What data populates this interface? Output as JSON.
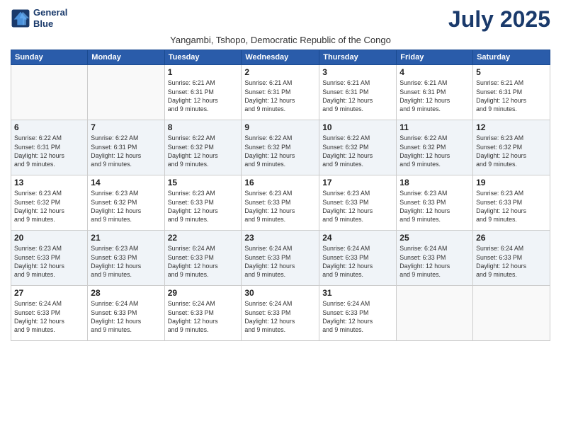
{
  "logo": {
    "line1": "General",
    "line2": "Blue"
  },
  "title": "July 2025",
  "subtitle": "Yangambi, Tshopo, Democratic Republic of the Congo",
  "weekdays": [
    "Sunday",
    "Monday",
    "Tuesday",
    "Wednesday",
    "Thursday",
    "Friday",
    "Saturday"
  ],
  "weeks": [
    [
      {
        "day": "",
        "info": ""
      },
      {
        "day": "",
        "info": ""
      },
      {
        "day": "1",
        "info": "Sunrise: 6:21 AM\nSunset: 6:31 PM\nDaylight: 12 hours\nand 9 minutes."
      },
      {
        "day": "2",
        "info": "Sunrise: 6:21 AM\nSunset: 6:31 PM\nDaylight: 12 hours\nand 9 minutes."
      },
      {
        "day": "3",
        "info": "Sunrise: 6:21 AM\nSunset: 6:31 PM\nDaylight: 12 hours\nand 9 minutes."
      },
      {
        "day": "4",
        "info": "Sunrise: 6:21 AM\nSunset: 6:31 PM\nDaylight: 12 hours\nand 9 minutes."
      },
      {
        "day": "5",
        "info": "Sunrise: 6:21 AM\nSunset: 6:31 PM\nDaylight: 12 hours\nand 9 minutes."
      }
    ],
    [
      {
        "day": "6",
        "info": "Sunrise: 6:22 AM\nSunset: 6:31 PM\nDaylight: 12 hours\nand 9 minutes."
      },
      {
        "day": "7",
        "info": "Sunrise: 6:22 AM\nSunset: 6:31 PM\nDaylight: 12 hours\nand 9 minutes."
      },
      {
        "day": "8",
        "info": "Sunrise: 6:22 AM\nSunset: 6:32 PM\nDaylight: 12 hours\nand 9 minutes."
      },
      {
        "day": "9",
        "info": "Sunrise: 6:22 AM\nSunset: 6:32 PM\nDaylight: 12 hours\nand 9 minutes."
      },
      {
        "day": "10",
        "info": "Sunrise: 6:22 AM\nSunset: 6:32 PM\nDaylight: 12 hours\nand 9 minutes."
      },
      {
        "day": "11",
        "info": "Sunrise: 6:22 AM\nSunset: 6:32 PM\nDaylight: 12 hours\nand 9 minutes."
      },
      {
        "day": "12",
        "info": "Sunrise: 6:23 AM\nSunset: 6:32 PM\nDaylight: 12 hours\nand 9 minutes."
      }
    ],
    [
      {
        "day": "13",
        "info": "Sunrise: 6:23 AM\nSunset: 6:32 PM\nDaylight: 12 hours\nand 9 minutes."
      },
      {
        "day": "14",
        "info": "Sunrise: 6:23 AM\nSunset: 6:32 PM\nDaylight: 12 hours\nand 9 minutes."
      },
      {
        "day": "15",
        "info": "Sunrise: 6:23 AM\nSunset: 6:33 PM\nDaylight: 12 hours\nand 9 minutes."
      },
      {
        "day": "16",
        "info": "Sunrise: 6:23 AM\nSunset: 6:33 PM\nDaylight: 12 hours\nand 9 minutes."
      },
      {
        "day": "17",
        "info": "Sunrise: 6:23 AM\nSunset: 6:33 PM\nDaylight: 12 hours\nand 9 minutes."
      },
      {
        "day": "18",
        "info": "Sunrise: 6:23 AM\nSunset: 6:33 PM\nDaylight: 12 hours\nand 9 minutes."
      },
      {
        "day": "19",
        "info": "Sunrise: 6:23 AM\nSunset: 6:33 PM\nDaylight: 12 hours\nand 9 minutes."
      }
    ],
    [
      {
        "day": "20",
        "info": "Sunrise: 6:23 AM\nSunset: 6:33 PM\nDaylight: 12 hours\nand 9 minutes."
      },
      {
        "day": "21",
        "info": "Sunrise: 6:23 AM\nSunset: 6:33 PM\nDaylight: 12 hours\nand 9 minutes."
      },
      {
        "day": "22",
        "info": "Sunrise: 6:24 AM\nSunset: 6:33 PM\nDaylight: 12 hours\nand 9 minutes."
      },
      {
        "day": "23",
        "info": "Sunrise: 6:24 AM\nSunset: 6:33 PM\nDaylight: 12 hours\nand 9 minutes."
      },
      {
        "day": "24",
        "info": "Sunrise: 6:24 AM\nSunset: 6:33 PM\nDaylight: 12 hours\nand 9 minutes."
      },
      {
        "day": "25",
        "info": "Sunrise: 6:24 AM\nSunset: 6:33 PM\nDaylight: 12 hours\nand 9 minutes."
      },
      {
        "day": "26",
        "info": "Sunrise: 6:24 AM\nSunset: 6:33 PM\nDaylight: 12 hours\nand 9 minutes."
      }
    ],
    [
      {
        "day": "27",
        "info": "Sunrise: 6:24 AM\nSunset: 6:33 PM\nDaylight: 12 hours\nand 9 minutes."
      },
      {
        "day": "28",
        "info": "Sunrise: 6:24 AM\nSunset: 6:33 PM\nDaylight: 12 hours\nand 9 minutes."
      },
      {
        "day": "29",
        "info": "Sunrise: 6:24 AM\nSunset: 6:33 PM\nDaylight: 12 hours\nand 9 minutes."
      },
      {
        "day": "30",
        "info": "Sunrise: 6:24 AM\nSunset: 6:33 PM\nDaylight: 12 hours\nand 9 minutes."
      },
      {
        "day": "31",
        "info": "Sunrise: 6:24 AM\nSunset: 6:33 PM\nDaylight: 12 hours\nand 9 minutes."
      },
      {
        "day": "",
        "info": ""
      },
      {
        "day": "",
        "info": ""
      }
    ]
  ]
}
